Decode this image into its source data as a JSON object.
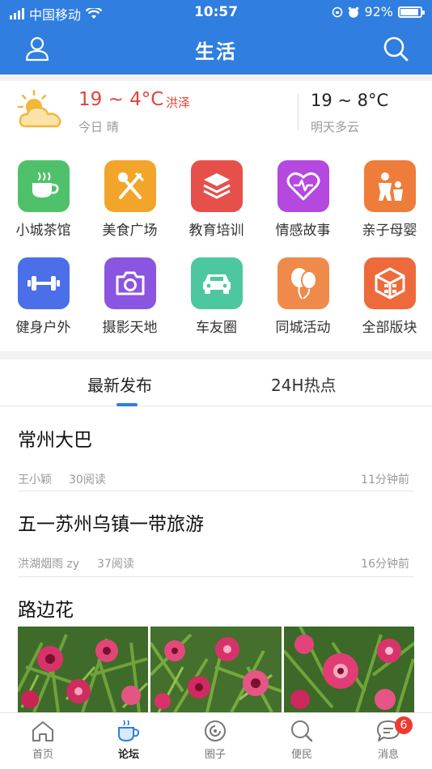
{
  "status_bar": {
    "carrier": "中国移动",
    "time": "10:57",
    "battery": "92%",
    "battery_level": 0.92
  },
  "header": {
    "title": "生活"
  },
  "weather": {
    "today_temp": "19 ~ 4°C",
    "location": "洪泽",
    "today_desc": "今日 晴",
    "tomorrow_temp": "19 ~ 8°C",
    "tomorrow_desc": "明天多云"
  },
  "categories": [
    {
      "label": "小城茶馆",
      "icon": "teacup-icon",
      "color": "#4fc16a"
    },
    {
      "label": "美食广场",
      "icon": "fork-knife-icon",
      "color": "#f2a52a"
    },
    {
      "label": "教育培训",
      "icon": "layers-icon",
      "color": "#e6504a"
    },
    {
      "label": "情感故事",
      "icon": "heart-pulse-icon",
      "color": "#b548df"
    },
    {
      "label": "亲子母婴",
      "icon": "parent-child-icon",
      "color": "#ef7d3a"
    },
    {
      "label": "健身户外",
      "icon": "dumbbell-icon",
      "color": "#4a6fe8"
    },
    {
      "label": "摄影天地",
      "icon": "camera-icon",
      "color": "#8a55e0"
    },
    {
      "label": "车友圈",
      "icon": "car-icon",
      "color": "#4dc7a0"
    },
    {
      "label": "同城活动",
      "icon": "balloons-icon",
      "color": "#f08a4a"
    },
    {
      "label": "全部版块",
      "icon": "cube-icon",
      "color": "#ee6a3a"
    }
  ],
  "tabs": {
    "latest": "最新发布",
    "hot": "24H热点"
  },
  "posts": [
    {
      "title": "常州大巴",
      "author": "王小颖",
      "reads": "30阅读",
      "time": "11分钟前"
    },
    {
      "title": "五一苏州乌镇一带旅游",
      "author": "洪湖烟雨 zy",
      "reads": "37阅读",
      "time": "16分钟前"
    },
    {
      "title": "路边花"
    }
  ],
  "tabbar": {
    "home": "首页",
    "forum": "论坛",
    "circle": "圈子",
    "convenience": "便民",
    "messages": "消息",
    "message_badge": "6"
  }
}
